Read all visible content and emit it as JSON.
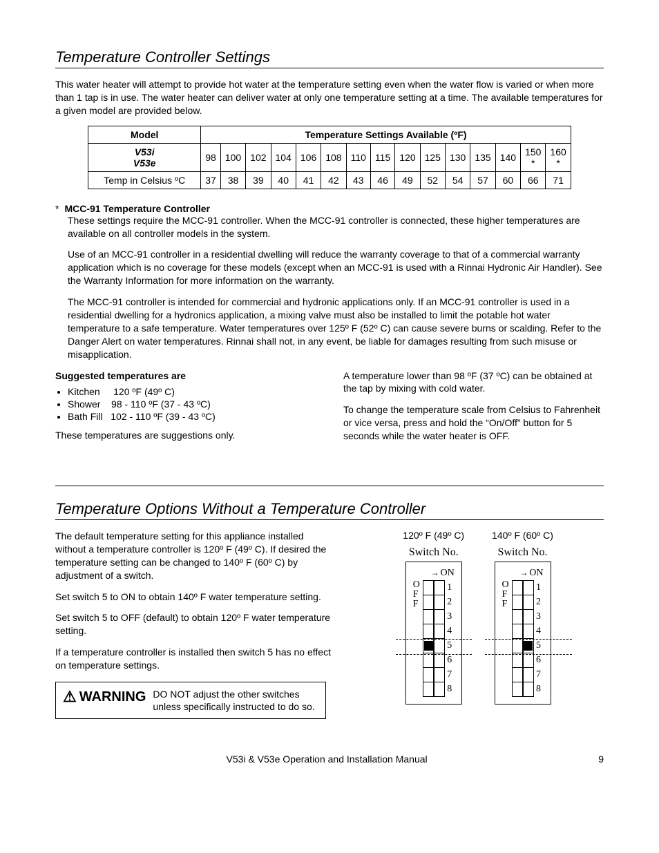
{
  "section1": {
    "title": "Temperature Controller Settings",
    "intro": "This water heater will attempt to provide hot water at the temperature setting even when the water flow is varied or when more than 1 tap is in use.  The water heater can deliver water at only one temperature setting at a time.  The available temperatures for a given model are provided below.",
    "table": {
      "h_model": "Model",
      "h_temp": "Temperature Settings Available (ºF)",
      "models": "V53i\nV53e",
      "row_c_label": "Temp in Celsius  ºC",
      "f": [
        "98",
        "100",
        "102",
        "104",
        "106",
        "108",
        "110",
        "115",
        "120",
        "125",
        "130",
        "135",
        "140",
        "150\n*",
        "160\n*"
      ],
      "c": [
        "37",
        "38",
        "39",
        "40",
        "41",
        "42",
        "43",
        "46",
        "49",
        "52",
        "54",
        "57",
        "60",
        "66",
        "71"
      ]
    },
    "note_star": "*",
    "note_title": "MCC-91 Temperature Controller",
    "note_p1": "These settings require the MCC-91 controller.  When the MCC-91 controller is connected, these higher temperatures are available on all controller models in the system.",
    "note_p2": "Use of an MCC-91 controller in a residential dwelling will reduce the warranty coverage to that of a commercial warranty application which is no coverage for these models (except when an MCC-91 is used with a Rinnai Hydronic Air Handler).  See the Warranty Information for more information on the warranty.",
    "note_p3": "The MCC-91 controller is intended for commercial and hydronic applications only. If an MCC-91 controller is used in a residential dwelling for a hydronics application, a mixing valve must also be installed to limit the potable hot water temperature to a safe temperature. Water temperatures over 125º F (52º C) can cause severe burns or scalding. Refer to the Danger Alert on water temperatures. Rinnai shall not, in any event, be liable for damages resulting from such misuse or misapplication.",
    "sugg_title": "Suggested temperatures are",
    "sugg_items": [
      "Kitchen     120 ºF (49º C)",
      "Shower    98 - 110 ºF (37 - 43 ºC)",
      "Bath Fill   102 - 110 ºF (39 - 43 ºC)"
    ],
    "sugg_foot": "These temperatures are suggestions only.",
    "right_p1": "A temperature lower than 98 ºF (37 ºC) can be obtained at the tap by mixing with cold water.",
    "right_p2": "To change the temperature scale from Celsius to Fahrenheit or vice versa, press and hold the “On/Off” button for 5 seconds while the water heater is OFF."
  },
  "section2": {
    "title": "Temperature Options Without a Temperature Controller",
    "p1": "The default temperature setting for this appliance installed without a temperature controller is 120º F (49º C).  If desired the temperature setting can be changed to 140º F (60º C) by adjustment of a switch.",
    "p2": "Set switch 5 to ON to obtain 140º F water temperature setting.",
    "p3": "Set switch 5 to OFF (default) to obtain 120º F water temperature setting.",
    "p4": "If a temperature controller is installed then switch 5 has no effect on temperature settings.",
    "warn_label": "WARNING",
    "warn_text": "DO NOT adjust the other switches unless specifically instructed to do so.",
    "dip_a_title": "120º F (49º C)",
    "dip_b_title": "140º F (60º C)",
    "switch_label": "Switch No.",
    "on_label": "ON",
    "off_label": "O\nF\nF",
    "nums": [
      "1",
      "2",
      "3",
      "4",
      "5",
      "6",
      "7",
      "8"
    ]
  },
  "footer": {
    "title": "V53i & V53e Operation and Installation Manual",
    "page": "9"
  },
  "chart_data": {
    "type": "table",
    "title": "Temperature Settings Available",
    "series": [
      {
        "name": "Fahrenheit (ºF)",
        "values": [
          98,
          100,
          102,
          104,
          106,
          108,
          110,
          115,
          120,
          125,
          130,
          135,
          140,
          150,
          160
        ]
      },
      {
        "name": "Celsius (ºC)",
        "values": [
          37,
          38,
          39,
          40,
          41,
          42,
          43,
          46,
          49,
          52,
          54,
          57,
          60,
          66,
          71
        ]
      }
    ],
    "annotations": {
      "150": "requires MCC-91",
      "160": "requires MCC-91"
    },
    "models": [
      "V53i",
      "V53e"
    ]
  }
}
